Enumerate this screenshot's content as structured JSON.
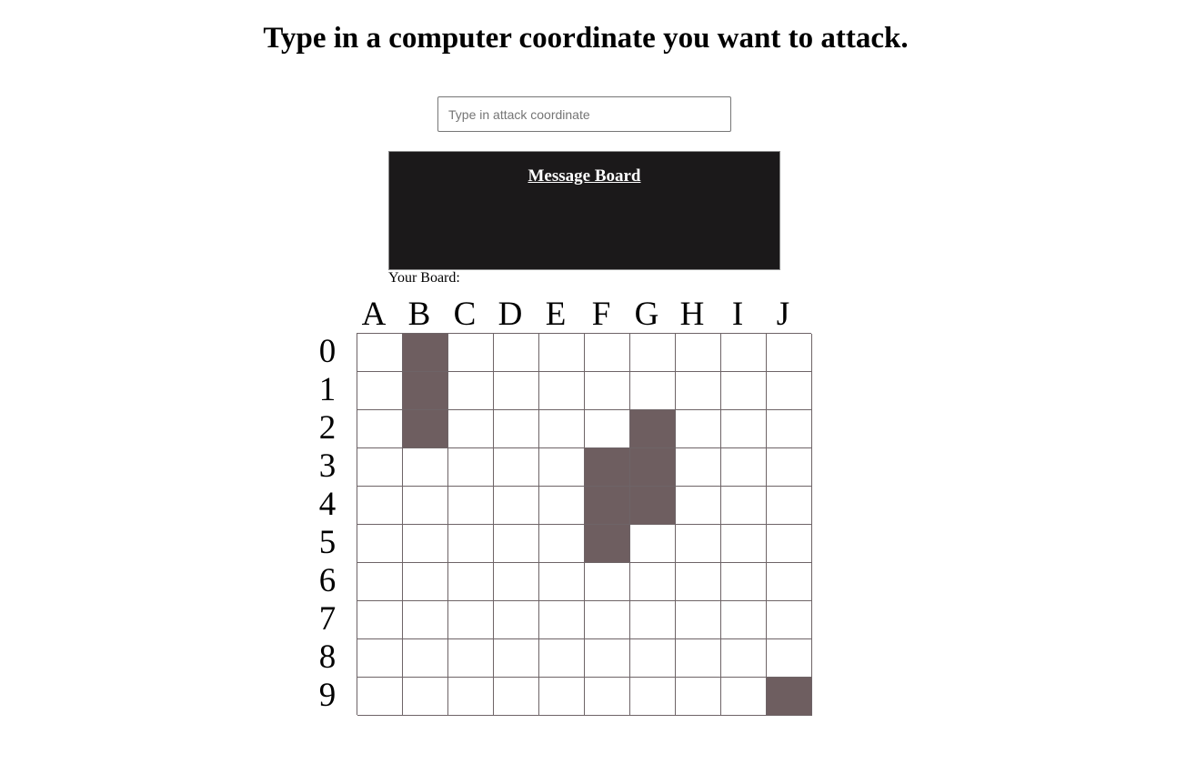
{
  "heading": "Type in a computer coordinate you want to attack.",
  "attack_input": {
    "placeholder": "Type in attack coordinate",
    "value": ""
  },
  "message_board": {
    "title": "Message Board",
    "messages": []
  },
  "your_board": {
    "label": "Your Board:",
    "columns": [
      "A",
      "B",
      "C",
      "D",
      "E",
      "F",
      "G",
      "H",
      "I",
      "J"
    ],
    "rows": [
      "0",
      "1",
      "2",
      "3",
      "4",
      "5",
      "6",
      "7",
      "8",
      "9"
    ],
    "ship_color": "#6e5e60",
    "ship_cells": [
      "B0",
      "B1",
      "B2",
      "G2",
      "F3",
      "G3",
      "F4",
      "G4",
      "F5",
      "J9"
    ]
  }
}
